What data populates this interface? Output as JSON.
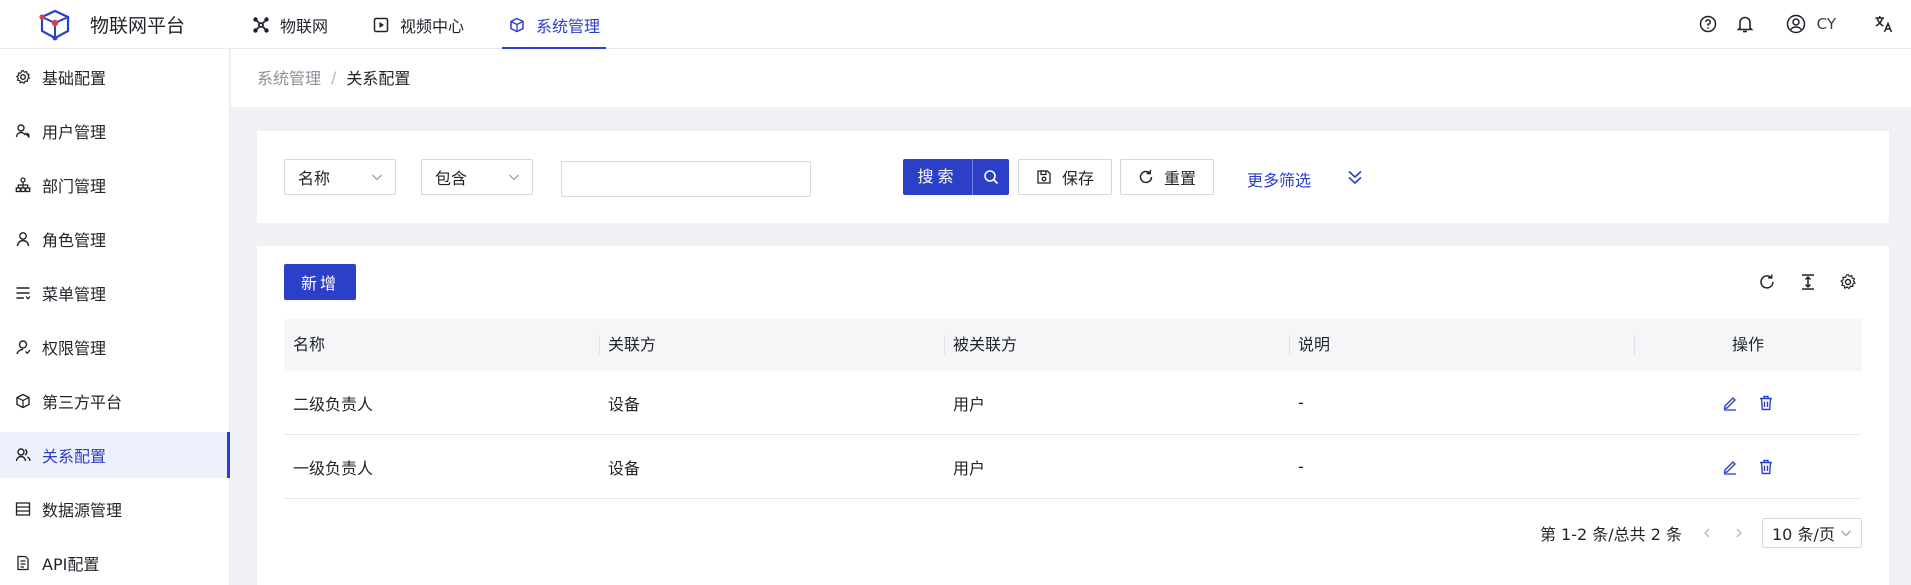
{
  "app": {
    "title": "物联网平台"
  },
  "topnav": [
    {
      "label": "物联网",
      "icon": "iot-icon"
    },
    {
      "label": "视频中心",
      "icon": "video-icon"
    },
    {
      "label": "系统管理",
      "icon": "system-icon",
      "active": true
    }
  ],
  "header_right": {
    "user_name": "CY"
  },
  "sidebar": {
    "items": [
      {
        "label": "基础配置",
        "icon": "gear-icon"
      },
      {
        "label": "用户管理",
        "icon": "user-manage-icon"
      },
      {
        "label": "部门管理",
        "icon": "department-icon"
      },
      {
        "label": "角色管理",
        "icon": "role-icon"
      },
      {
        "label": "菜单管理",
        "icon": "menu-icon"
      },
      {
        "label": "权限管理",
        "icon": "permission-icon"
      },
      {
        "label": "第三方平台",
        "icon": "third-party-icon"
      },
      {
        "label": "关系配置",
        "icon": "relation-icon",
        "active": true
      },
      {
        "label": "数据源管理",
        "icon": "datasource-icon"
      },
      {
        "label": "API配置",
        "icon": "api-icon"
      }
    ]
  },
  "breadcrumb": {
    "parent": "系统管理",
    "separator": "/",
    "current": "关系配置"
  },
  "filter": {
    "field_select": "名称",
    "operator_select": "包含",
    "keyword_value": "",
    "search_label": "搜索",
    "save_label": "保存",
    "reset_label": "重置",
    "more_label": "更多筛选"
  },
  "toolbar": {
    "add_label": "新增"
  },
  "table": {
    "columns": [
      "名称",
      "关联方",
      "被关联方",
      "说明",
      "操作"
    ],
    "rows": [
      {
        "name": "二级负责人",
        "source": "设备",
        "target": "用户",
        "desc": "-"
      },
      {
        "name": "一级负责人",
        "source": "设备",
        "target": "用户",
        "desc": "-"
      }
    ]
  },
  "pagination": {
    "summary": "第 1-2 条/总共 2 条",
    "page_size": "10 条/页"
  },
  "colors": {
    "primary": "#2c3fc8",
    "background": "#f0f1f5"
  }
}
